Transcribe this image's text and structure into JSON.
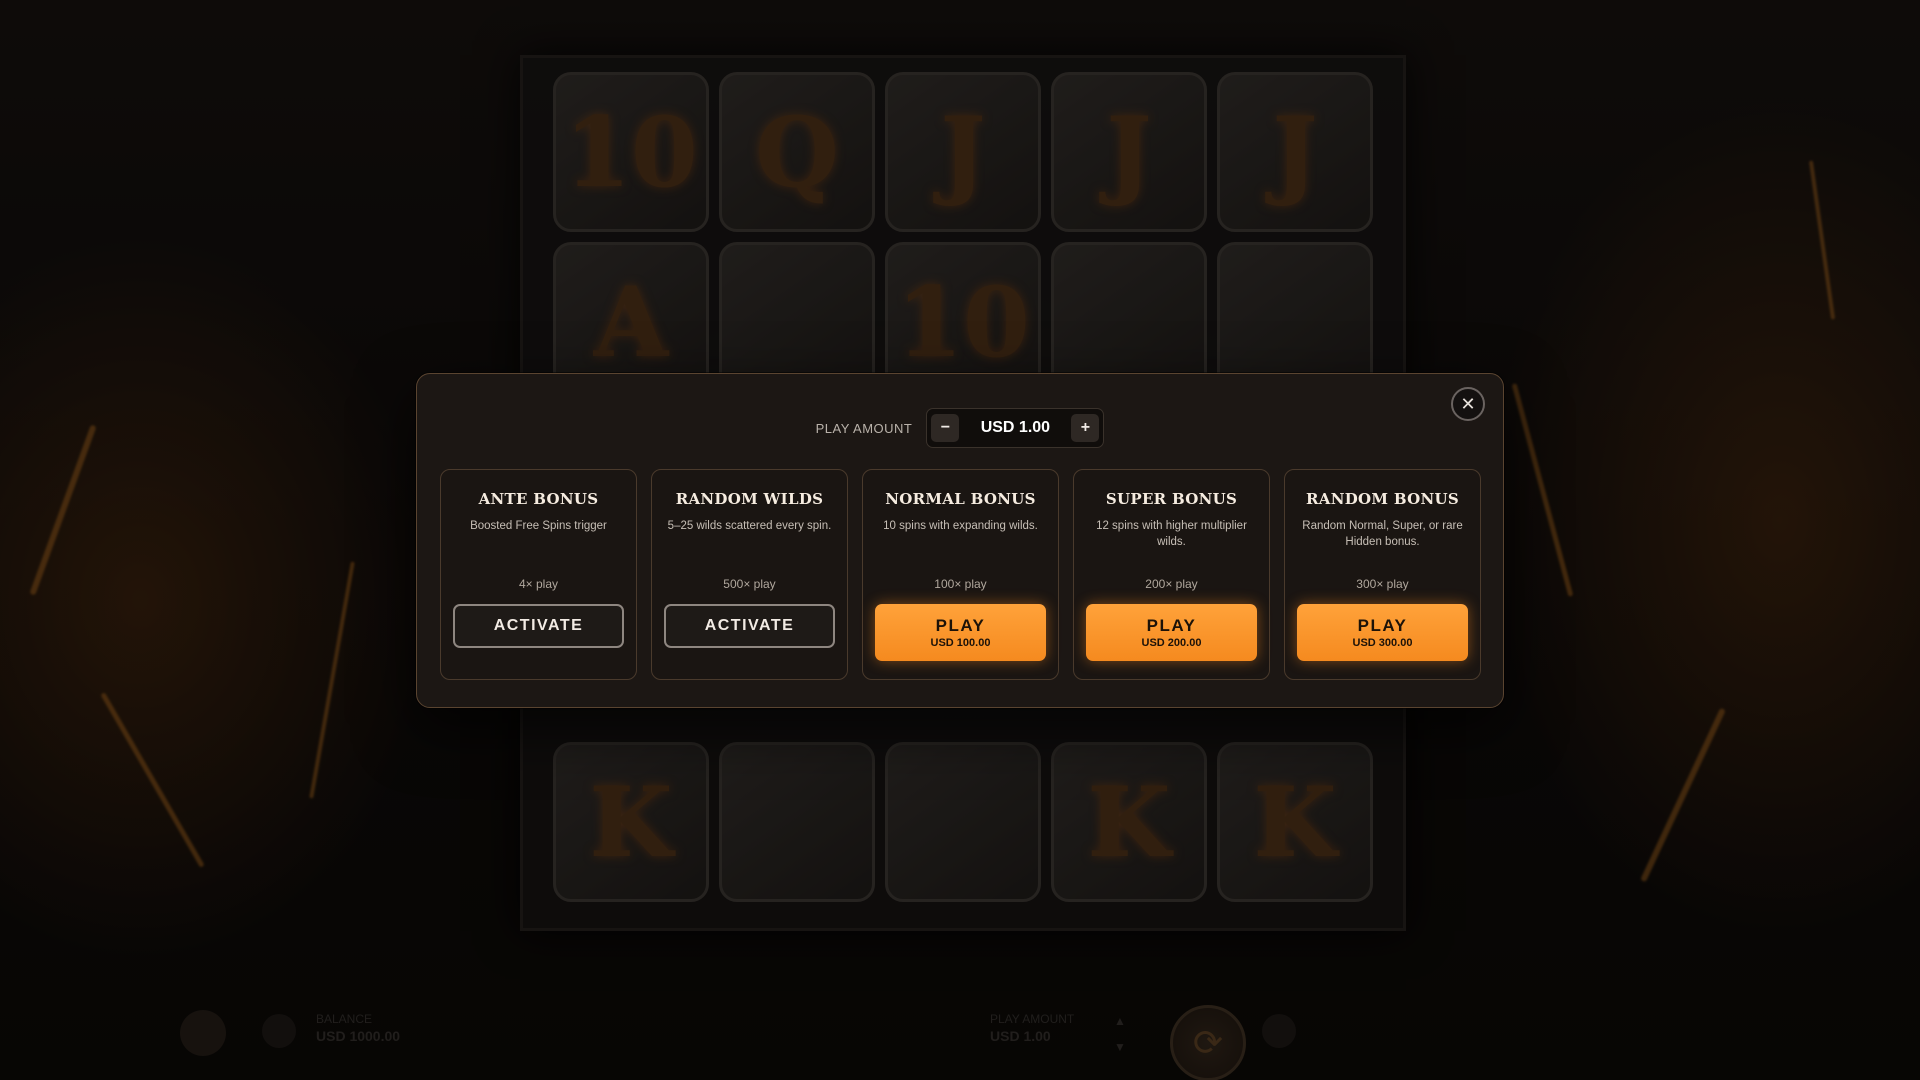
{
  "modal": {
    "play_amount_label": "PLAY AMOUNT",
    "play_amount_value": "USD 1.00",
    "decrease_symbol": "−",
    "increase_symbol": "+",
    "close_symbol": "✕"
  },
  "cards": [
    {
      "title": "ANTE BONUS",
      "description": "Boosted Free Spins trigger",
      "multiplier": "4× play",
      "button_label": "ACTIVATE",
      "button_amount": ""
    },
    {
      "title": "RANDOM WILDS",
      "description": "5–25 wilds scattered every spin.",
      "multiplier": "500× play",
      "button_label": "ACTIVATE",
      "button_amount": ""
    },
    {
      "title": "NORMAL BONUS",
      "description": "10 spins with expanding wilds.",
      "multiplier": "100× play",
      "button_label": "PLAY",
      "button_amount": "USD 100.00"
    },
    {
      "title": "SUPER BONUS",
      "description": "12 spins with higher multiplier wilds.",
      "multiplier": "200× play",
      "button_label": "PLAY",
      "button_amount": "USD 200.00"
    },
    {
      "title": "RANDOM BONUS",
      "description": "Random Normal, Super, or rare Hidden bonus.",
      "multiplier": "300× play",
      "button_label": "PLAY",
      "button_amount": "USD 300.00"
    }
  ],
  "reels": {
    "row1": [
      "10",
      "Q",
      "J",
      "J",
      "J"
    ],
    "row2": [
      "A",
      "",
      "10",
      "",
      ""
    ],
    "row3": [
      "K",
      "",
      "",
      "K",
      "K"
    ]
  },
  "bottom_bar": {
    "balance_label": "BALANCE",
    "balance_value": "USD 1000.00",
    "play_amount_label": "PLAY AMOUNT",
    "play_amount_value": "USD 1.00"
  },
  "colors": {
    "accent": "#f58a1f",
    "modal_bg": "#1c1714",
    "card_border": "#4a3a2c"
  },
  "icons": {
    "close": "close-icon",
    "minus": "minus-icon",
    "plus": "plus-icon",
    "spin": "spin-icon"
  }
}
